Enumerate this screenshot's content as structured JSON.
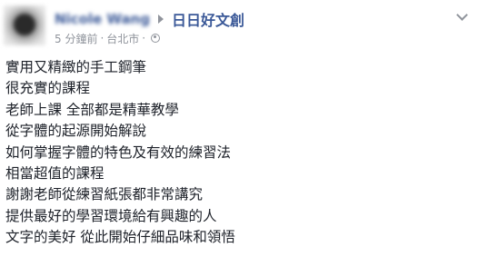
{
  "post": {
    "author_name": "Nicole Wang",
    "page_name": "日日好文創",
    "time": "5 分鐘前",
    "location": "台北市",
    "separator": "·",
    "audience_icon": "globe-icon",
    "lines": [
      "實用又精緻的手工鋼筆",
      "很充實的課程",
      "老師上課 全部都是精華教學",
      "從字體的起源開始解說",
      "如何掌握字體的特色及有效的練習法",
      "相當超值的課程",
      "謝謝老師從練習紙張都非常講究",
      "提供最好的學習環境給有興趣的人",
      "文字的美好 從此開始仔細品味和領悟"
    ]
  },
  "colors": {
    "link": "#3b5998",
    "meta": "#90949c",
    "text": "#1d2129"
  }
}
